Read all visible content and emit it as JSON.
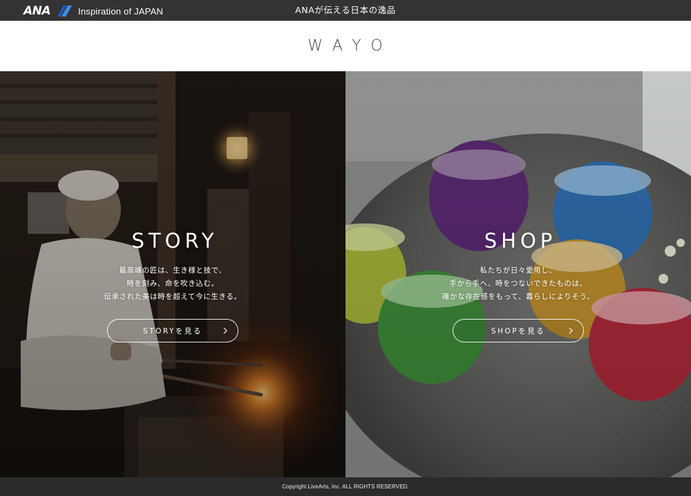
{
  "topbar": {
    "brand_logo": "ANA",
    "brand_tagline": "Inspiration of JAPAN",
    "title": "ANAが伝える日本の逸品",
    "bg_color": "#333333"
  },
  "header": {
    "logo": "WAYO"
  },
  "panels": [
    {
      "id": "story",
      "title": "STORY",
      "description": [
        "最高峰の匠は、生き様と技で、",
        "時を刻み、命を吹き込む。",
        "伝承された美は時を超えて今に生きる。"
      ],
      "button_label": "STORYを見る",
      "icon": "chevron-right-icon"
    },
    {
      "id": "shop",
      "title": "SHOP",
      "description": [
        "私たちが日々愛用し、",
        "手から手へ、時をつないできたものは、",
        "確かな存在感をもって、暮らしによりそう。"
      ],
      "button_label": "SHOPを見る",
      "icon": "chevron-right-icon"
    }
  ],
  "footer": {
    "copyright": "Copyright LiveArts, Inc. ALL RIGHTS RESERVED."
  }
}
